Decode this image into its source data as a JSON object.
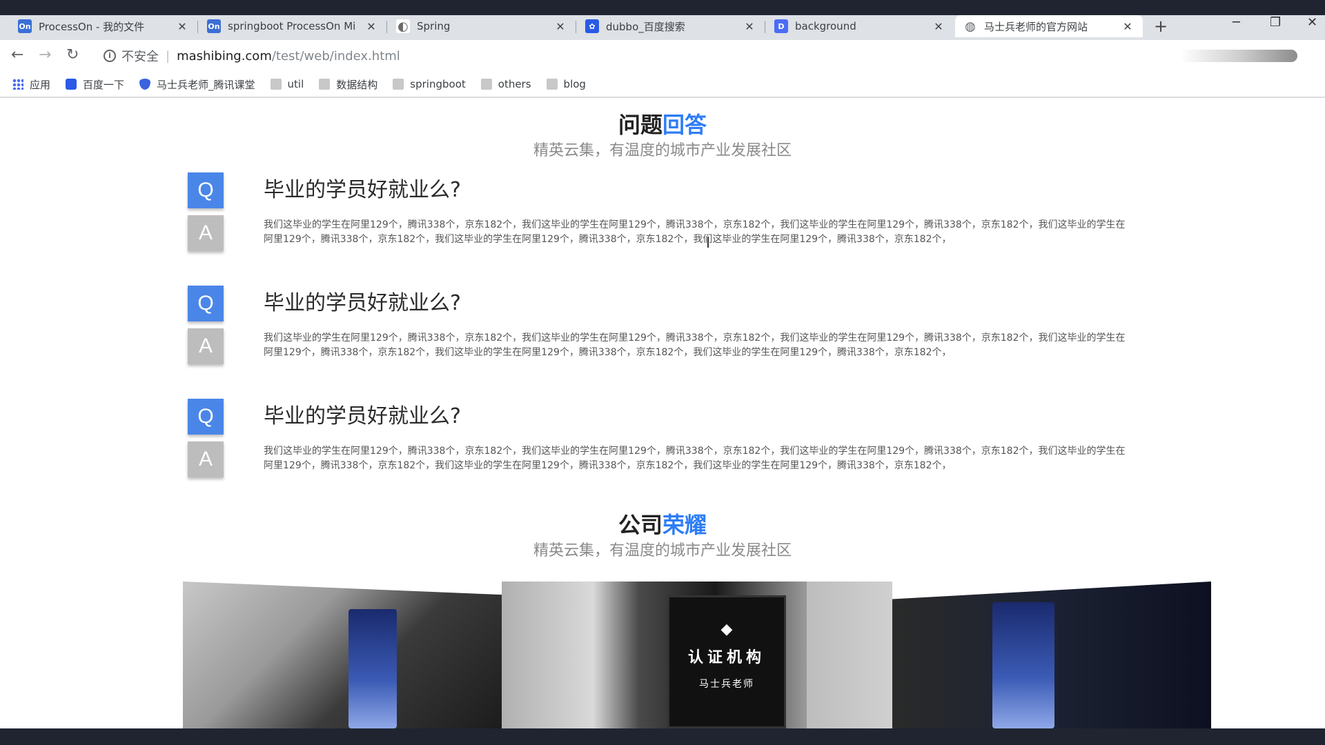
{
  "browser": {
    "tabs": [
      {
        "title": "ProcessOn - 我的文件",
        "icon": "processon-icon",
        "color": "#3b6fd6",
        "glyph": "On"
      },
      {
        "title": "springboot ProcessOn Mi",
        "icon": "processon-icon",
        "color": "#3b6fd6",
        "glyph": "On"
      },
      {
        "title": "Spring",
        "icon": "spring-icon",
        "color": "#6b6b6b",
        "glyph": "◐"
      },
      {
        "title": "dubbo_百度搜索",
        "icon": "baidu-paw-icon",
        "color": "#2a5ae6",
        "glyph": "🐾"
      },
      {
        "title": "background",
        "icon": "document-icon",
        "color": "#4a6cf7",
        "glyph": "D"
      },
      {
        "title": "马士兵老师的官方网站",
        "icon": "globe-icon",
        "color": "#5f6368",
        "glyph": "◍"
      }
    ],
    "active_tab": 5,
    "address": {
      "security_label": "不安全",
      "host": "mashibing.com",
      "path": "/test/web/index.html"
    },
    "bookmarks": [
      {
        "label": "应用",
        "icon": "apps-grid-icon"
      },
      {
        "label": "百度一下",
        "icon": "baidu-icon"
      },
      {
        "label": "马士兵老师_腾讯课堂",
        "icon": "tencent-classroom-icon"
      },
      {
        "label": "util",
        "icon": "folder-icon"
      },
      {
        "label": "数据结构",
        "icon": "folder-icon"
      },
      {
        "label": "springboot",
        "icon": "folder-icon"
      },
      {
        "label": "others",
        "icon": "folder-icon"
      },
      {
        "label": "blog",
        "icon": "folder-icon"
      }
    ]
  },
  "qa_section": {
    "title_main": "问题",
    "title_accent": "回答",
    "subtitle": "精英云集，有温度的城市产业发展社区",
    "items": [
      {
        "q_badge": "Q",
        "a_badge": "A",
        "question": "毕业的学员好就业么?",
        "answer": "我们这毕业的学生在阿里129个，腾讯338个，京东182个，我们这毕业的学生在阿里129个，腾讯338个，京东182个，我们这毕业的学生在阿里129个，腾讯338个，京东182个，我们这毕业的学生在阿里129个，腾讯338个，京东182个，我们这毕业的学生在阿里129个，腾讯338个，京东182个，我们这毕业的学生在阿里129个，腾讯338个，京东182个，"
      },
      {
        "q_badge": "Q",
        "a_badge": "A",
        "question": "毕业的学员好就业么?",
        "answer": "我们这毕业的学生在阿里129个，腾讯338个，京东182个，我们这毕业的学生在阿里129个，腾讯338个，京东182个，我们这毕业的学生在阿里129个，腾讯338个，京东182个，我们这毕业的学生在阿里129个，腾讯338个，京东182个，我们这毕业的学生在阿里129个，腾讯338个，京东182个，我们这毕业的学生在阿里129个，腾讯338个，京东182个，"
      },
      {
        "q_badge": "Q",
        "a_badge": "A",
        "question": "毕业的学员好就业么?",
        "answer": "我们这毕业的学生在阿里129个，腾讯338个，京东182个，我们这毕业的学生在阿里129个，腾讯338个，京东182个，我们这毕业的学生在阿里129个，腾讯338个，京东182个，我们这毕业的学生在阿里129个，腾讯338个，京东182个，我们这毕业的学生在阿里129个，腾讯338个，京东182个，我们这毕业的学生在阿里129个，腾讯338个，京东182个，"
      }
    ]
  },
  "honors_section": {
    "title_main": "公司",
    "title_accent": "荣耀",
    "subtitle": "精英云集，有温度的城市产业发展社区",
    "plaque": {
      "heading": "认证机构",
      "name": "马士兵老师"
    }
  },
  "colors": {
    "accent": "#2e7df6",
    "q_badge": "#4a86e8",
    "a_badge": "#bdbdbd"
  }
}
